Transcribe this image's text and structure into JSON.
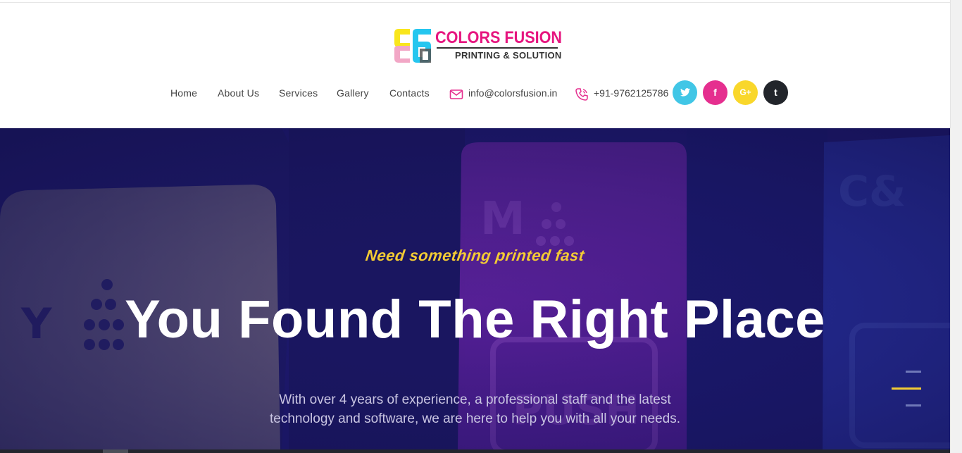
{
  "brand": {
    "name": "COLORS FUSION",
    "tagline": "PRINTING & SOLUTION",
    "colors": {
      "magenta": "#e6157f",
      "yellow": "#f9e61c",
      "cyan": "#25c6ef",
      "dark": "#333333"
    }
  },
  "nav": {
    "items": [
      {
        "label": "Home"
      },
      {
        "label": "About Us"
      },
      {
        "label": "Services"
      },
      {
        "label": "Gallery"
      },
      {
        "label": "Contacts"
      }
    ],
    "email": {
      "icon": "envelope-icon",
      "label": "info@colorsfusion.in"
    },
    "phone": {
      "icon": "phone-icon",
      "label": "+91-9762125786"
    },
    "social": [
      {
        "name": "twitter",
        "icon": "twitter-icon",
        "glyph": "t",
        "color": "#41c6e6"
      },
      {
        "name": "facebook",
        "icon": "facebook-icon",
        "glyph": "f",
        "color": "#e52f8f"
      },
      {
        "name": "google-plus",
        "icon": "google-plus-icon",
        "glyph": "G+",
        "color": "#f9d72b"
      },
      {
        "name": "tumblr",
        "icon": "tumblr-icon",
        "glyph": "t",
        "color": "#22252b"
      }
    ]
  },
  "hero": {
    "eyebrow": "Need something printed fast",
    "headline": "You Found The Right Place",
    "lead_line1": "With over 4 years of experience, a professional staff and the latest",
    "lead_line2": "technology and software, we are here to help you with all your needs.",
    "slider": {
      "total": 3,
      "active_index": 1
    },
    "accent": "#f4cc34"
  }
}
